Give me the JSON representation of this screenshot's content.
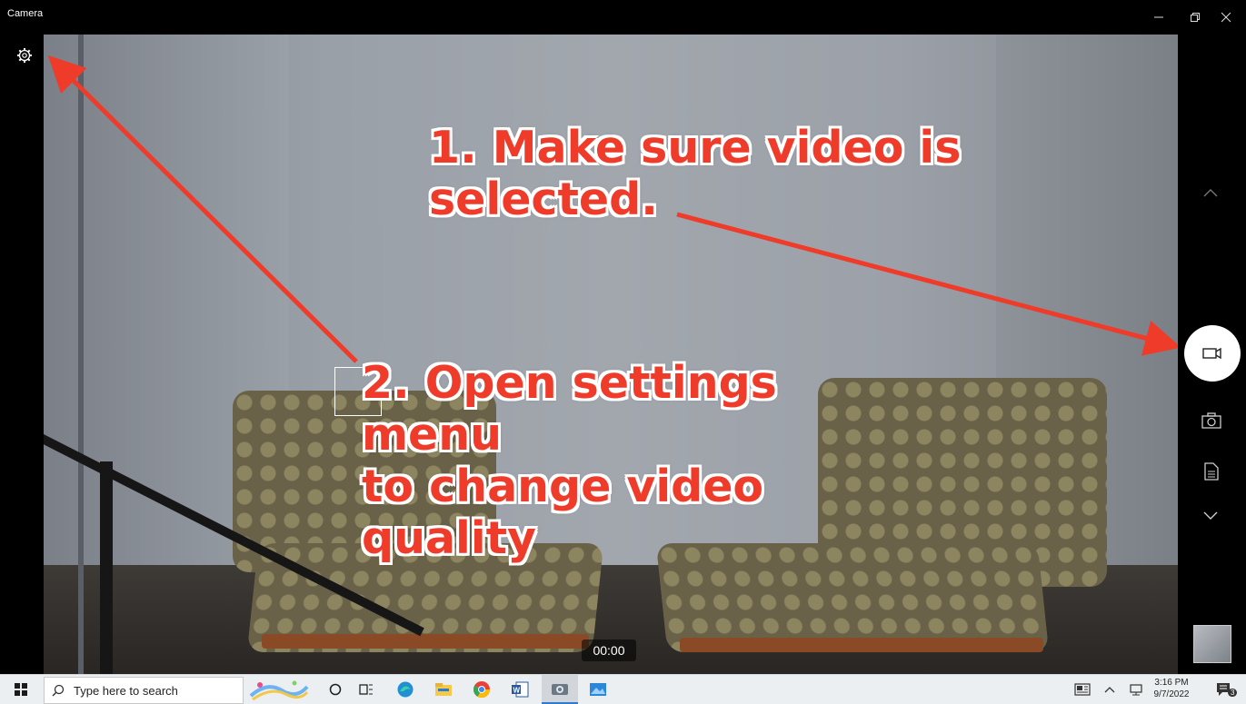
{
  "window": {
    "title": "Camera"
  },
  "viewfinder": {
    "timer": "00:00"
  },
  "annotations": {
    "step1_line1": "1. Make sure video is",
    "step1_line2": "selected.",
    "step2_line1": "2. Open settings",
    "step2_line2": "menu",
    "step2_line3": "to change video",
    "step2_line4": "quality"
  },
  "taskbar": {
    "search_placeholder": "Type here to search",
    "time": "3:16 PM",
    "date": "9/7/2022",
    "notification_count": "3"
  },
  "colors": {
    "annotation": "#ef3b2a",
    "taskbar": "#eceff1"
  }
}
